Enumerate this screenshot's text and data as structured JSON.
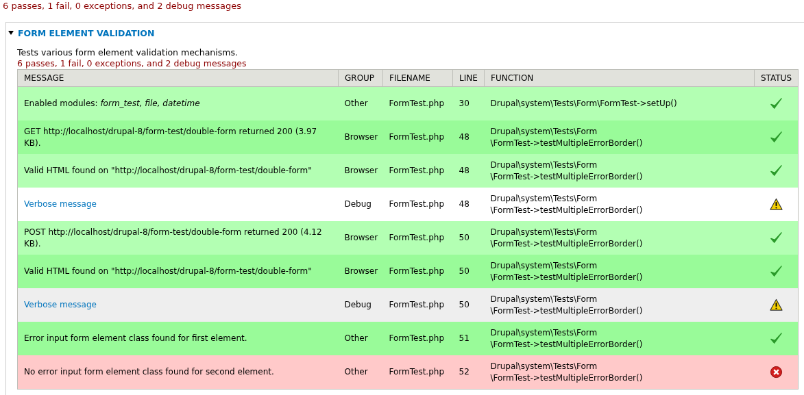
{
  "summary": "6 passes, 1 fail, 0 exceptions, and 2 debug messages",
  "group": {
    "title": "FORM ELEMENT VALIDATION",
    "expanded": true,
    "description": "Tests various form element validation mechanisms.",
    "summary": "6 passes, 1 fail, 0 exceptions, and 2 debug messages"
  },
  "table": {
    "columns": [
      "MESSAGE",
      "GROUP",
      "FILENAME",
      "LINE",
      "FUNCTION",
      "STATUS"
    ],
    "rows": [
      {
        "message": "Enabled modules: *form_test, file, datetime*",
        "link": false,
        "group": "Other",
        "filename": "FormTest.php",
        "line": "30",
        "function": "Drupal\\system\\Tests\\Form\\FormTest->setUp()",
        "kind": "pass"
      },
      {
        "message": "GET http://localhost/drupal-8/form-test/double-form returned 200 (3.97 KB).",
        "link": false,
        "group": "Browser",
        "filename": "FormTest.php",
        "line": "48",
        "function": "Drupal\\system\\Tests\\Form\\FormTest->testMultipleErrorBorder()",
        "kind": "pass"
      },
      {
        "message": "Valid HTML found on \"http://localhost/drupal-8/form-test/double-form\"",
        "link": false,
        "group": "Browser",
        "filename": "FormTest.php",
        "line": "48",
        "function": "Drupal\\system\\Tests\\Form\\FormTest->testMultipleErrorBorder()",
        "kind": "pass"
      },
      {
        "message": "Verbose message",
        "link": true,
        "group": "Debug",
        "filename": "FormTest.php",
        "line": "48",
        "function": "Drupal\\system\\Tests\\Form\\FormTest->testMultipleErrorBorder()",
        "kind": "debug"
      },
      {
        "message": "POST http://localhost/drupal-8/form-test/double-form returned 200 (4.12 KB).",
        "link": false,
        "group": "Browser",
        "filename": "FormTest.php",
        "line": "50",
        "function": "Drupal\\system\\Tests\\Form\\FormTest->testMultipleErrorBorder()",
        "kind": "pass"
      },
      {
        "message": "Valid HTML found on \"http://localhost/drupal-8/form-test/double-form\"",
        "link": false,
        "group": "Browser",
        "filename": "FormTest.php",
        "line": "50",
        "function": "Drupal\\system\\Tests\\Form\\FormTest->testMultipleErrorBorder()",
        "kind": "pass"
      },
      {
        "message": "Verbose message",
        "link": true,
        "group": "Debug",
        "filename": "FormTest.php",
        "line": "50",
        "function": "Drupal\\system\\Tests\\Form\\FormTest->testMultipleErrorBorder()",
        "kind": "debug"
      },
      {
        "message": "Error input form element class found for first element.",
        "link": false,
        "group": "Other",
        "filename": "FormTest.php",
        "line": "51",
        "function": "Drupal\\system\\Tests\\Form\\FormTest->testMultipleErrorBorder()",
        "kind": "pass"
      },
      {
        "message": "No error input form element class found for second element.",
        "link": false,
        "group": "Other",
        "filename": "FormTest.php",
        "line": "52",
        "function": "Drupal\\system\\Tests\\Form\\FormTest->testMultipleErrorBorder()",
        "kind": "fail"
      }
    ]
  }
}
